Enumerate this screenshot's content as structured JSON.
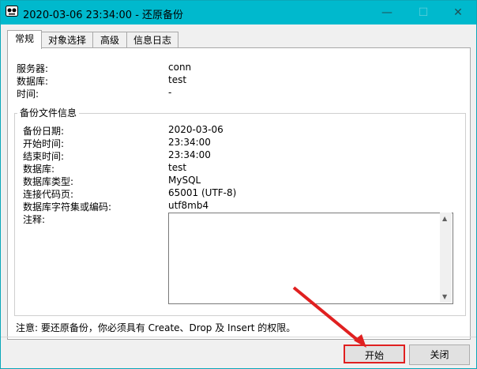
{
  "window": {
    "title": "2020-03-06 23:34:00 - 还原备份"
  },
  "tabs": [
    "常规",
    "对象选择",
    "高级",
    "信息日志"
  ],
  "general": {
    "rows": [
      {
        "label": "服务器:",
        "value": "conn"
      },
      {
        "label": "数据库:",
        "value": "test"
      },
      {
        "label": "时间:",
        "value": "-"
      }
    ]
  },
  "backup_info": {
    "title": "备份文件信息",
    "rows": [
      {
        "label": "备份日期:",
        "value": "2020-03-06"
      },
      {
        "label": "开始时间:",
        "value": "23:34:00"
      },
      {
        "label": "结束时间:",
        "value": "23:34:00"
      },
      {
        "label": "数据库:",
        "value": "test"
      },
      {
        "label": "数据库类型:",
        "value": "MySQL"
      },
      {
        "label": "连接代码页:",
        "value": "65001 (UTF-8)"
      },
      {
        "label": "数据库字符集或编码:",
        "value": "utf8mb4"
      }
    ],
    "notes_label": "注释:",
    "notes_value": ""
  },
  "notice": "注意: 要还原备份，你必须具有 Create、Drop 及 Insert 的权限。",
  "buttons": {
    "start": "开始",
    "close": "关闭"
  }
}
